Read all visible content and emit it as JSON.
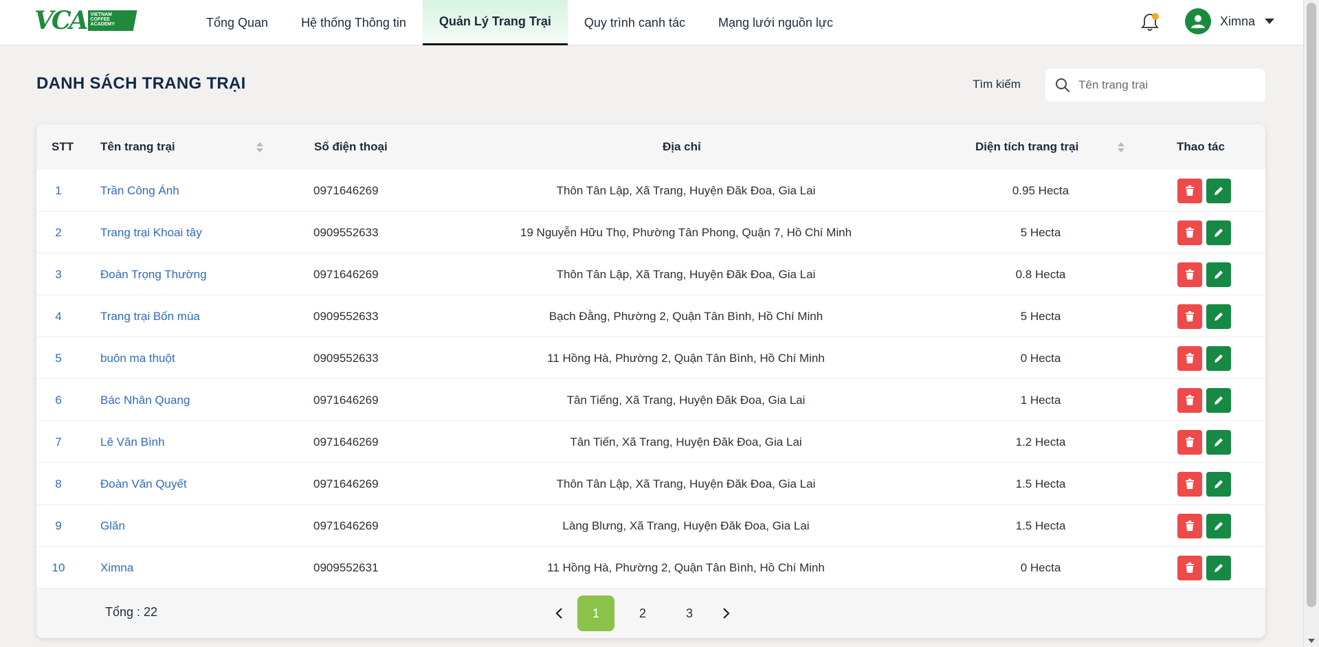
{
  "colors": {
    "brand_green": "#1f8a3c",
    "active_page": "#8bc34a",
    "delete_button": "#ef4a4a",
    "edit_button": "#168a45",
    "link_blue": "#2f6bbf",
    "notification_dot": "#f5a623"
  },
  "logo": {
    "letters": "VCA",
    "tagline_1": "VIETNAM",
    "tagline_2": "COFFEE",
    "tagline_3": "ACADEMY"
  },
  "nav": {
    "items": [
      {
        "label": "Tổng Quan"
      },
      {
        "label": "Hệ thống Thông tin"
      },
      {
        "label": "Quản Lý Trang Trại",
        "active": true
      },
      {
        "label": "Quy trình canh tác"
      },
      {
        "label": "Mạng lưới nguồn lực"
      }
    ]
  },
  "header": {
    "notification_icon": "bell-icon",
    "user_name": "Ximna"
  },
  "page": {
    "title": "DANH SÁCH TRANG TRẠI",
    "search_label": "Tìm kiếm",
    "search_placeholder": "Tên trang trại"
  },
  "table": {
    "columns": {
      "stt": "STT",
      "name": "Tên trang trại",
      "phone": "Số điện thoại",
      "address": "Địa chỉ",
      "area": "Diện tích trang trại",
      "actions": "Thao tác"
    },
    "rows": [
      {
        "stt": "1",
        "name": "Trần Công Ánh",
        "phone": "0971646269",
        "address": "Thôn Tân Lập, Xã Trang, Huyện Đăk Đoa, Gia Lai",
        "area": "0.95 Hecta"
      },
      {
        "stt": "2",
        "name": "Trang trại Khoai tây",
        "phone": "0909552633",
        "address": "19 Nguyễn Hữu Thọ, Phường Tân Phong, Quận 7, Hồ Chí Minh",
        "area": "5 Hecta"
      },
      {
        "stt": "3",
        "name": "Đoàn Trọng Thường",
        "phone": "0971646269",
        "address": "Thôn Tân Lập, Xã Trang, Huyện Đăk Đoa, Gia Lai",
        "area": "0.8 Hecta"
      },
      {
        "stt": "4",
        "name": "Trang trại Bốn mùa",
        "phone": "0909552633",
        "address": "Bạch Đằng, Phường 2, Quận Tân Bình, Hồ Chí Minh",
        "area": "5 Hecta"
      },
      {
        "stt": "5",
        "name": "buôn ma thuột",
        "phone": "0909552633",
        "address": "11 Hồng Hà, Phường 2, Quận Tân Bình, Hồ Chí Minh",
        "area": "0 Hecta"
      },
      {
        "stt": "6",
        "name": "Bác Nhân Quang",
        "phone": "0971646269",
        "address": "Tân Tiếng, Xã Trang, Huyện Đăk Đoa, Gia Lai",
        "area": "1 Hecta"
      },
      {
        "stt": "7",
        "name": "Lê Văn Bình",
        "phone": "0971646269",
        "address": "Tân Tiến, Xã Trang, Huyện Đăk Đoa, Gia Lai",
        "area": "1.2 Hecta"
      },
      {
        "stt": "8",
        "name": "Đoàn Văn Quyết",
        "phone": "0971646269",
        "address": "Thôn Tân Lập, Xã Trang, Huyện Đăk Đoa, Gia Lai",
        "area": "1.5 Hecta"
      },
      {
        "stt": "9",
        "name": "Glăn",
        "phone": "0971646269",
        "address": "Làng Blưng, Xã Trang, Huyện Đăk Đoa, Gia Lai",
        "area": "1.5 Hecta"
      },
      {
        "stt": "10",
        "name": "Ximna",
        "phone": "0909552631",
        "address": "11 Hồng Hà, Phường 2, Quận Tân Bình, Hồ Chí Minh",
        "area": "0 Hecta"
      }
    ],
    "row_actions": {
      "delete_icon": "trash-icon",
      "edit_icon": "pencil-icon"
    }
  },
  "footer": {
    "total_label": "Tổng : 22",
    "pages": [
      "1",
      "2",
      "3"
    ],
    "current_page": "1"
  }
}
